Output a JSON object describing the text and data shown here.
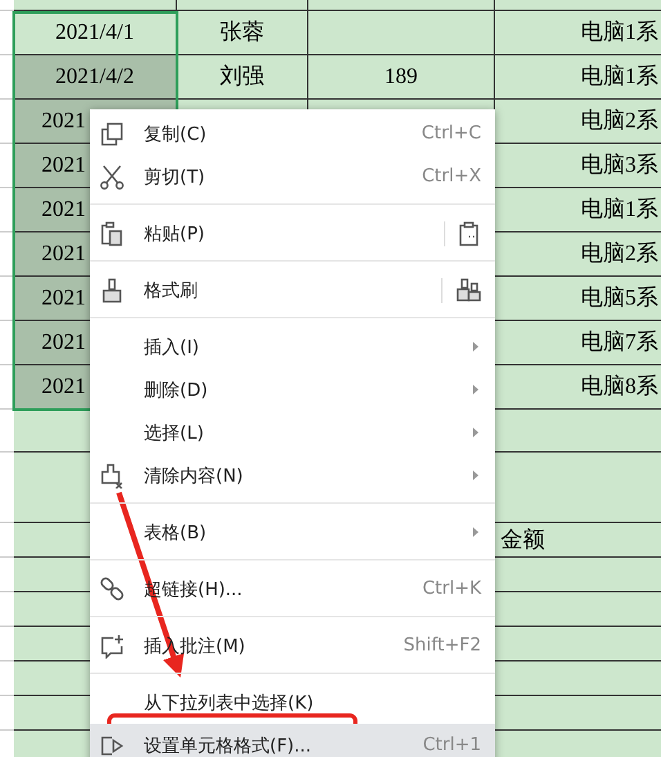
{
  "sheet": {
    "rows": [
      {
        "column_1": "2021/4/1",
        "column_2": "张蓉",
        "column_4": "电脑1系",
        "selected": false
      },
      {
        "column_1": "2021/4/2",
        "column_2": "刘强",
        "column_3": "189",
        "column_4": "电脑1系",
        "selected": true
      },
      {
        "column_1": "2021",
        "column_4": "电脑2系",
        "selected": true
      },
      {
        "column_1": "2021",
        "column_4": "电脑3系",
        "selected": true
      },
      {
        "column_1": "2021",
        "column_4": "电脑1系",
        "selected": true
      },
      {
        "column_1": "2021",
        "column_4": "电脑2系",
        "selected": true
      },
      {
        "column_1": "2021",
        "column_4": "电脑5系",
        "selected": true
      },
      {
        "column_1": "2021",
        "column_4": "电脑7系",
        "selected": true
      },
      {
        "column_1": "2021",
        "column_4": "电脑8系",
        "selected": true
      },
      {},
      {},
      {
        "column_4": "金额"
      }
    ]
  },
  "context_menu": {
    "items": [
      {
        "label": "复制(C)",
        "shortcut": "Ctrl+C",
        "submenu": false,
        "divider_after": false,
        "selected": false
      },
      {
        "label": "剪切(T)",
        "shortcut": "Ctrl+X",
        "submenu": false,
        "divider_after": true,
        "selected": false
      },
      {
        "label": "粘贴(P)",
        "submenu": false,
        "divider_after": true,
        "selected": false
      },
      {
        "label": "格式刷",
        "submenu": false,
        "divider_after": true,
        "selected": false
      },
      {
        "label": "插入(I)",
        "submenu": true,
        "divider_after": false,
        "selected": false
      },
      {
        "label": "删除(D)",
        "submenu": true,
        "divider_after": false,
        "selected": false
      },
      {
        "label": "选择(L)",
        "submenu": true,
        "divider_after": false,
        "selected": false
      },
      {
        "label": "清除内容(N)",
        "submenu": true,
        "divider_after": true,
        "selected": false
      },
      {
        "label": "表格(B)",
        "submenu": true,
        "divider_after": true,
        "selected": false
      },
      {
        "label": "超链接(H)...",
        "shortcut": "Ctrl+K",
        "submenu": false,
        "divider_after": true,
        "selected": false
      },
      {
        "label": "插入批注(M)",
        "shortcut": "Shift+F2",
        "submenu": false,
        "divider_after": true,
        "selected": false
      },
      {
        "label": "从下拉列表中选择(K)",
        "submenu": false,
        "divider_after": false,
        "selected": false
      },
      {
        "label": "设置单元格格式(F)...",
        "shortcut": "Ctrl+1",
        "submenu": false,
        "divider_after": false,
        "selected": true
      }
    ]
  }
}
